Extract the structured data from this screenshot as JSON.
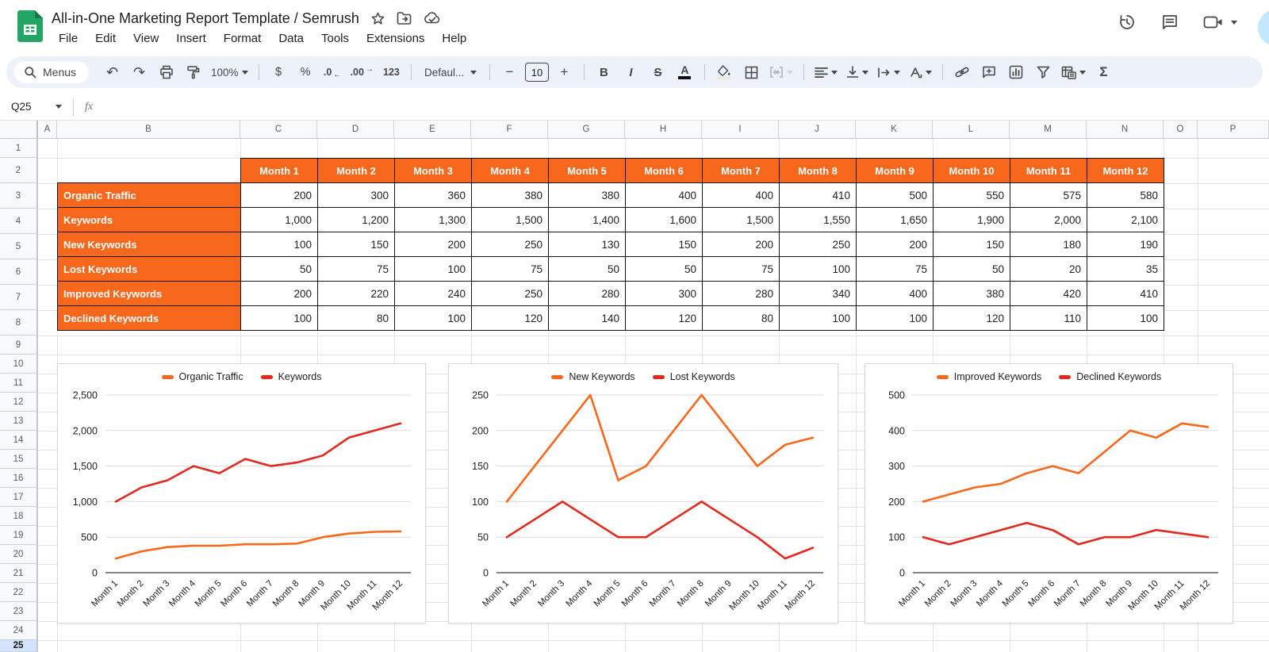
{
  "app": {
    "title": "All-in-One Marketing Report Template / Semrush",
    "menu": [
      "File",
      "Edit",
      "View",
      "Insert",
      "Format",
      "Data",
      "Tools",
      "Extensions",
      "Help"
    ],
    "title_icons": [
      "star-icon",
      "move-folder-icon",
      "cloud-saved-icon"
    ],
    "right_icons": [
      "version-history-icon",
      "comments-icon",
      "video-call-icon",
      "caret-down-icon"
    ]
  },
  "toolbar": {
    "menus_label": "Menus",
    "zoom_value": "100%",
    "currency_label": "$",
    "percent_label": "%",
    "decrease_decimal_label": ".0",
    "increase_decimal_label": ".00",
    "more_formats_label": "123",
    "font_name": "Defaul...",
    "font_size": "10",
    "bold_label": "B",
    "italic_label": "I",
    "strikethrough_label": "S",
    "text_color_label": "A",
    "functions_label": "Σ"
  },
  "formula_bar": {
    "name_box": "Q25",
    "fx_label": "fx",
    "formula_value": ""
  },
  "grid": {
    "columns": [
      "A",
      "B",
      "C",
      "D",
      "E",
      "F",
      "G",
      "H",
      "I",
      "J",
      "K",
      "L",
      "M",
      "N",
      "O",
      "P"
    ],
    "rows": [
      "1",
      "2",
      "3",
      "4",
      "5",
      "6",
      "7",
      "8",
      "9",
      "10",
      "11",
      "12",
      "13",
      "14",
      "15",
      "16",
      "17",
      "18",
      "19",
      "20",
      "21",
      "22",
      "23",
      "24",
      "25"
    ],
    "selected_row": "25"
  },
  "table": {
    "column_headers": [
      "Month 1",
      "Month 2",
      "Month 3",
      "Month 4",
      "Month 5",
      "Month 6",
      "Month 7",
      "Month 8",
      "Month 9",
      "Month 10",
      "Month 11",
      "Month 12"
    ],
    "rows": [
      {
        "label": "Organic Traffic",
        "values": [
          "200",
          "300",
          "360",
          "380",
          "380",
          "400",
          "400",
          "410",
          "500",
          "550",
          "575",
          "580"
        ]
      },
      {
        "label": "Keywords",
        "values": [
          "1,000",
          "1,200",
          "1,300",
          "1,500",
          "1,400",
          "1,600",
          "1,500",
          "1,550",
          "1,650",
          "1,900",
          "2,000",
          "2,100"
        ]
      },
      {
        "label": "New Keywords",
        "values": [
          "100",
          "150",
          "200",
          "250",
          "130",
          "150",
          "200",
          "250",
          "200",
          "150",
          "180",
          "190"
        ]
      },
      {
        "label": "Lost Keywords",
        "values": [
          "50",
          "75",
          "100",
          "75",
          "50",
          "50",
          "75",
          "100",
          "75",
          "50",
          "20",
          "35"
        ]
      },
      {
        "label": "Improved Keywords",
        "values": [
          "200",
          "220",
          "240",
          "250",
          "280",
          "300",
          "280",
          "340",
          "400",
          "380",
          "420",
          "410"
        ]
      },
      {
        "label": "Declined Keywords",
        "values": [
          "100",
          "80",
          "100",
          "120",
          "140",
          "120",
          "80",
          "100",
          "100",
          "120",
          "110",
          "100"
        ]
      }
    ]
  },
  "colors": {
    "orange": "#F8681C",
    "red": "#E3281D",
    "row_highlight": "#d3e3fd",
    "toolbar_bg": "#edf2fa"
  },
  "chart_data": [
    {
      "type": "line",
      "categories": [
        "Month 1",
        "Month 2",
        "Month 3",
        "Month 4",
        "Month 5",
        "Month 6",
        "Month 7",
        "Month 8",
        "Month 9",
        "Month 10",
        "Month 11",
        "Month 12"
      ],
      "series": [
        {
          "name": "Organic Traffic",
          "color": "#F8681C",
          "values": [
            200,
            300,
            360,
            380,
            380,
            400,
            400,
            410,
            500,
            550,
            575,
            580
          ]
        },
        {
          "name": "Keywords",
          "color": "#E3281D",
          "values": [
            1000,
            1200,
            1300,
            1500,
            1400,
            1600,
            1500,
            1550,
            1650,
            1900,
            2000,
            2100
          ]
        }
      ],
      "ylim": [
        0,
        2500
      ],
      "yticks": [
        0,
        500,
        1000,
        1500,
        2000,
        2500
      ],
      "grid": true,
      "legend_position": "top",
      "title": "",
      "xlabel": "",
      "ylabel": ""
    },
    {
      "type": "line",
      "categories": [
        "Month 1",
        "Month 2",
        "Month 3",
        "Month 4",
        "Month 5",
        "Month 6",
        "Month 7",
        "Month 8",
        "Month 9",
        "Month 10",
        "Month 11",
        "Month 12"
      ],
      "series": [
        {
          "name": "New Keywords",
          "color": "#F8681C",
          "values": [
            100,
            150,
            200,
            250,
            130,
            150,
            200,
            250,
            200,
            150,
            180,
            190
          ]
        },
        {
          "name": "Lost Keywords",
          "color": "#E3281D",
          "values": [
            50,
            75,
            100,
            75,
            50,
            50,
            75,
            100,
            75,
            50,
            20,
            35
          ]
        }
      ],
      "ylim": [
        0,
        250
      ],
      "yticks": [
        0,
        50,
        100,
        150,
        200,
        250
      ],
      "grid": true,
      "legend_position": "top",
      "title": "",
      "xlabel": "",
      "ylabel": ""
    },
    {
      "type": "line",
      "categories": [
        "Month 1",
        "Month 2",
        "Month 3",
        "Month 4",
        "Month 5",
        "Month 6",
        "Month 7",
        "Month 8",
        "Month 9",
        "Month 10",
        "Month 11",
        "Month 12"
      ],
      "series": [
        {
          "name": "Improved Keywords",
          "color": "#F8681C",
          "values": [
            200,
            220,
            240,
            250,
            280,
            300,
            280,
            340,
            400,
            380,
            420,
            410
          ]
        },
        {
          "name": "Declined Keywords",
          "color": "#E3281D",
          "values": [
            100,
            80,
            100,
            120,
            140,
            120,
            80,
            100,
            100,
            120,
            110,
            100
          ]
        }
      ],
      "ylim": [
        0,
        500
      ],
      "yticks": [
        0,
        100,
        200,
        300,
        400,
        500
      ],
      "grid": true,
      "legend_position": "top",
      "title": "",
      "xlabel": "",
      "ylabel": ""
    }
  ]
}
